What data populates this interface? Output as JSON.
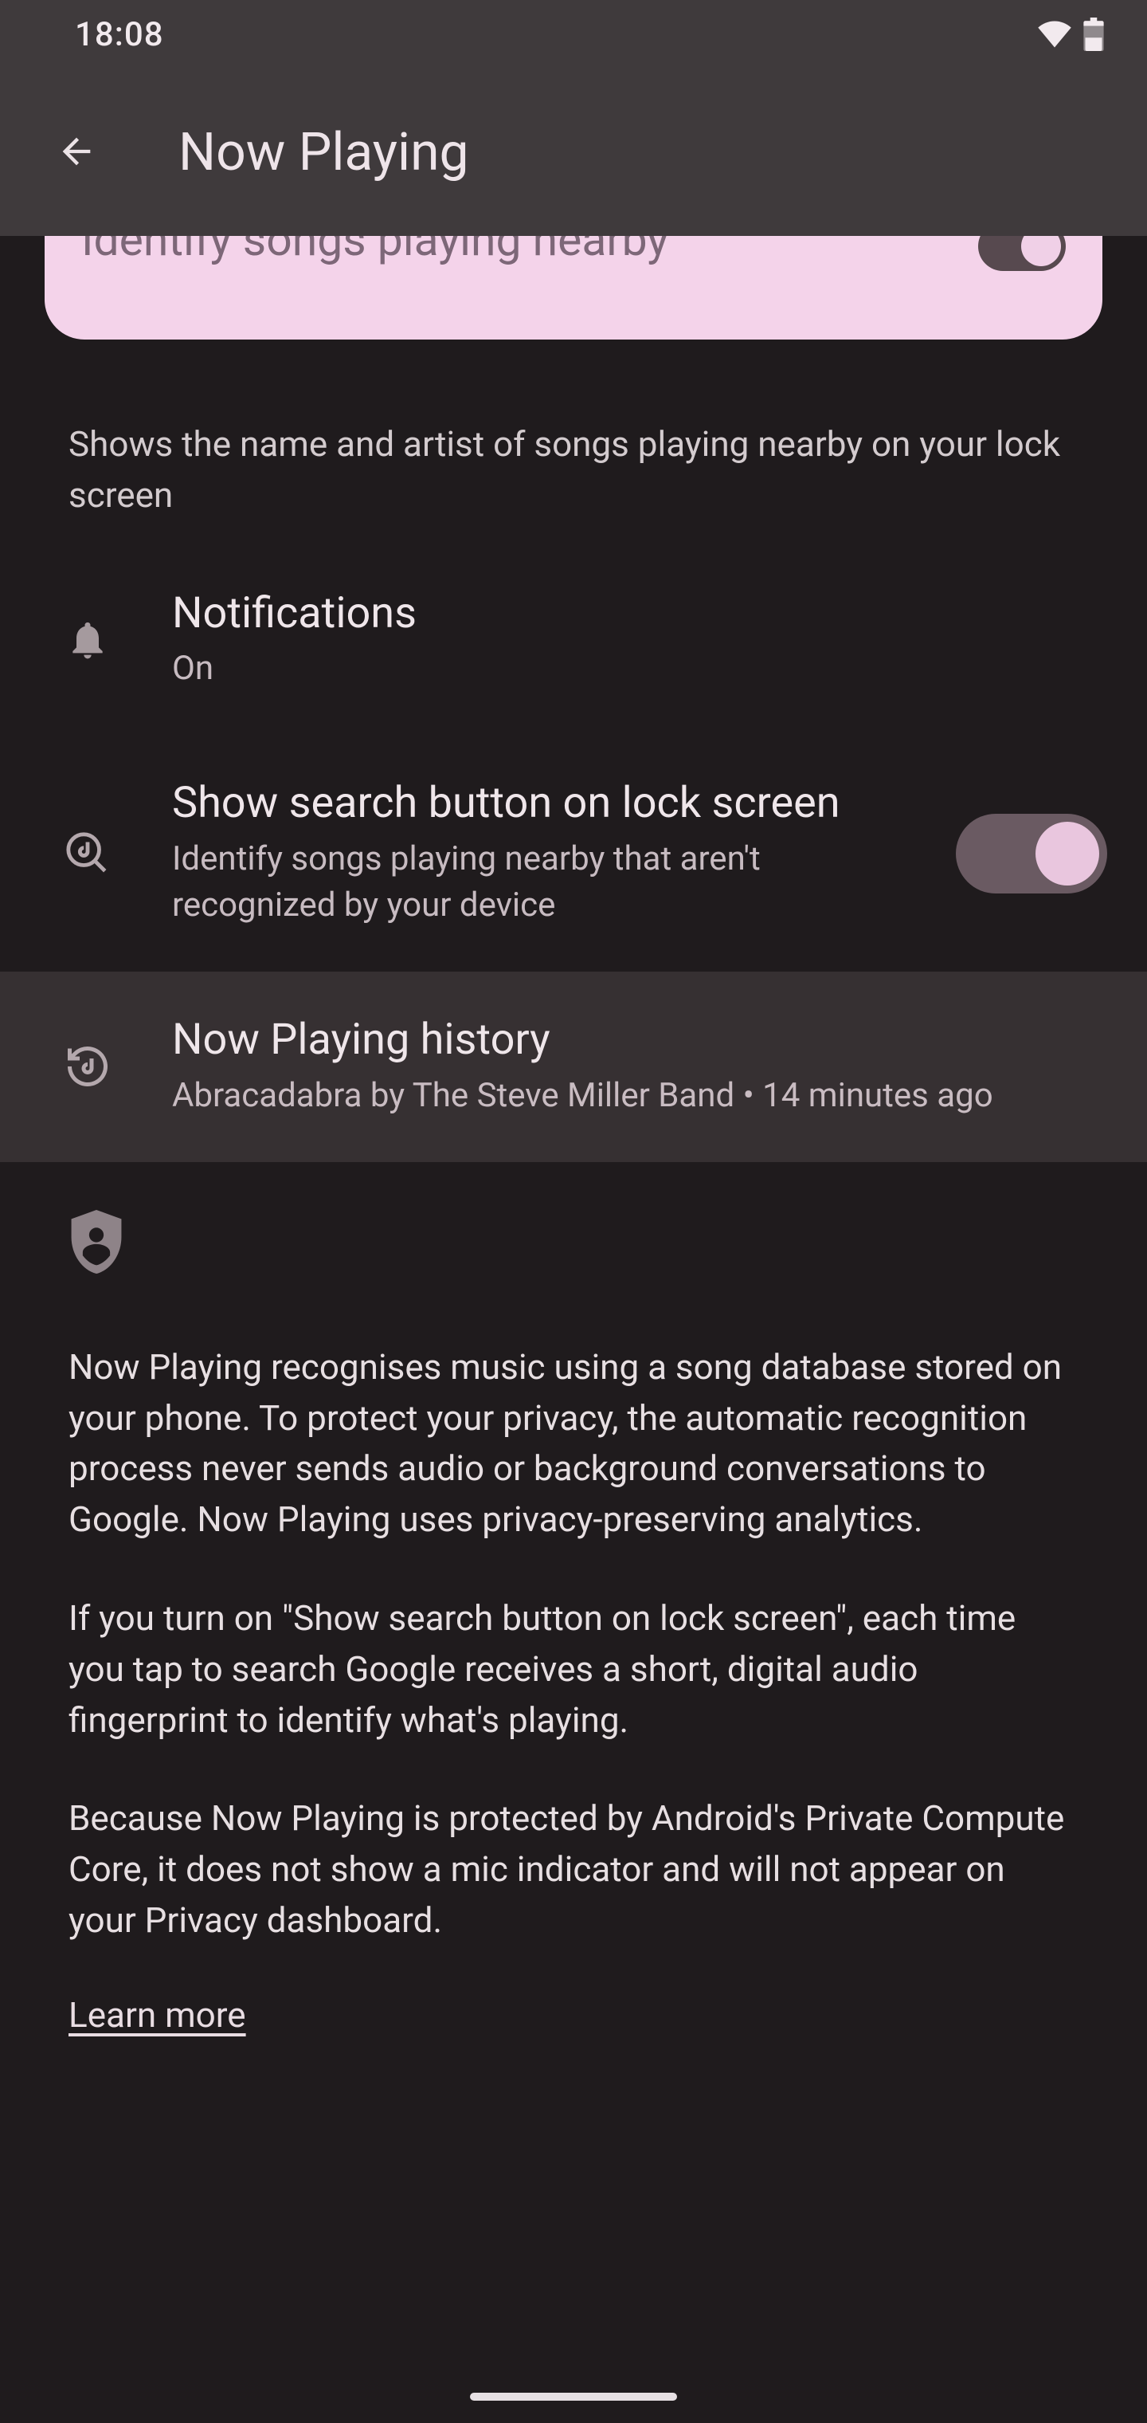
{
  "statusbar": {
    "time": "18:08"
  },
  "appbar": {
    "title": "Now Playing"
  },
  "hero": {
    "title": "Identify songs playing nearby",
    "description": "Shows the name and artist of songs playing nearby on your lock screen"
  },
  "settings": {
    "notifications": {
      "title": "Notifications",
      "status": "On"
    },
    "searchButton": {
      "title": "Show search button on lock screen",
      "description": "Identify songs playing nearby that aren't recognized by your device"
    },
    "history": {
      "title": "Now Playing history",
      "subtitle": "Abracadabra by The Steve Miller Band • 14 minutes ago"
    }
  },
  "privacy": {
    "para1": "Now Playing recognises music using a song database stored on your phone. To protect your privacy, the automatic recognition process never sends audio or background conversations to Google. Now Playing uses privacy-preserving analytics.",
    "para2": "If you turn on \"Show search button on lock screen\", each time you tap to search Google receives a short, digital audio fingerprint to identify what's playing.",
    "para3": "Because Now Playing is protected by Android's Private Compute Core, it does not show a mic indicator and will not appear on your Privacy dashboard.",
    "learn_more": "Learn more"
  }
}
